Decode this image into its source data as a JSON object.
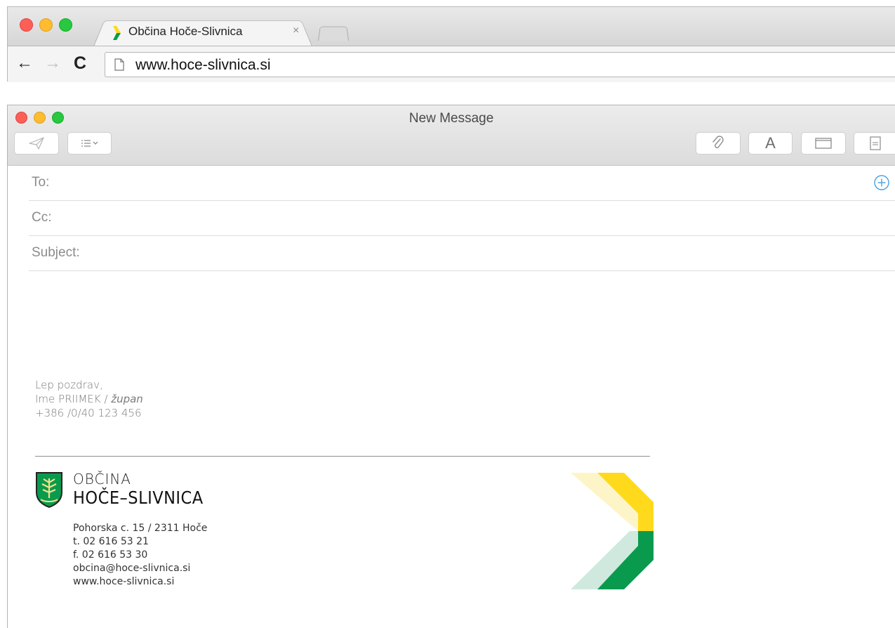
{
  "browser": {
    "tab_title": "Občina Hoče-Slivnica",
    "tab_close": "×",
    "url": "www.hoce-slivnica.si",
    "back": "←",
    "forward": "→",
    "reload": "C"
  },
  "mail": {
    "window_title": "New Message",
    "font_button": "A",
    "fields": {
      "to": "To:",
      "cc": "Cc:",
      "subject": "Subject:"
    },
    "signature": {
      "greeting": "Lep pozdrav,",
      "name": "Ime PRIIMEK / ",
      "role": "župan",
      "phone": "+386 /0/40 123 456"
    },
    "logo": {
      "line1": "OBČINA",
      "line2": "HOČE–SLIVNICA"
    },
    "contact": {
      "address": "Pohorska c. 15  /  2311 Hoče",
      "tel": "t. 02 616 53 21",
      "fax": "f. 02 616 53 30",
      "email": "obcina@hoce-slivnica.si",
      "web": "www.hoce-slivnica.si"
    }
  },
  "colors": {
    "accent_blue": "#4a9fe3",
    "brand_green": "#0a9a4e",
    "brand_yellow": "#ffd91c",
    "light_yellow": "#fdf5c8",
    "light_green": "#cfe9df"
  }
}
